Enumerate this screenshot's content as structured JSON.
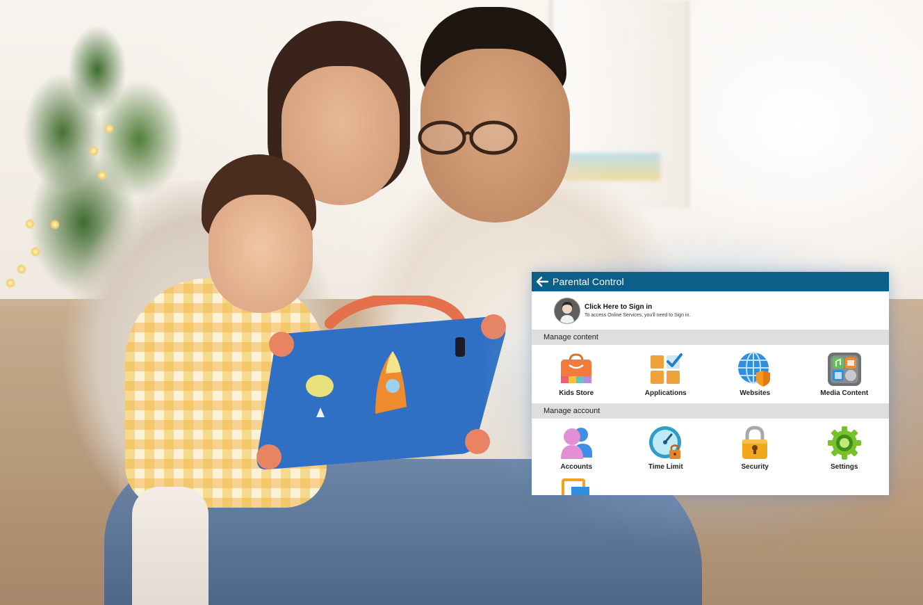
{
  "window": {
    "title": "Parental Control"
  },
  "signin": {
    "title": "Click Here to Sign in",
    "subtitle": "To access Online Services, you'll need to Sign in."
  },
  "sections": [
    {
      "heading": "Manage content",
      "items": [
        {
          "label": "Kids Store",
          "icon": "shopping-bag-icon"
        },
        {
          "label": "Applications",
          "icon": "applications-grid-icon"
        },
        {
          "label": "Websites",
          "icon": "globe-shield-icon"
        },
        {
          "label": "Media Content",
          "icon": "media-content-icon"
        }
      ]
    },
    {
      "heading": "Manage account",
      "items": [
        {
          "label": "Accounts",
          "icon": "accounts-icon"
        },
        {
          "label": "Time Limit",
          "icon": "time-limit-icon"
        },
        {
          "label": "Security",
          "icon": "padlock-icon"
        },
        {
          "label": "Settings",
          "icon": "gear-icon"
        }
      ]
    }
  ],
  "colors": {
    "titlebar": "#0b5f88",
    "section_bg": "#dedede"
  }
}
